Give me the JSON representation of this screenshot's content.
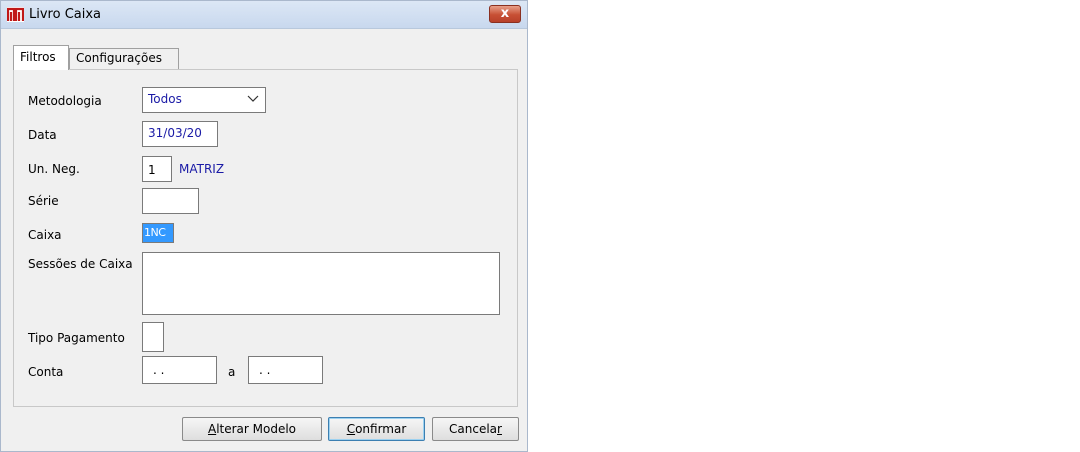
{
  "window": {
    "title": "Livro Caixa",
    "close_label": "x"
  },
  "tabs": [
    {
      "label": "Filtros",
      "active": true
    },
    {
      "label": "Configurações",
      "active": false
    }
  ],
  "form": {
    "metodologia": {
      "label": "Metodologia",
      "value": "Todos"
    },
    "data": {
      "label": "Data",
      "value": "31/03/20"
    },
    "un_neg": {
      "label": "Un. Neg.",
      "value": "1",
      "description": "MATRIZ"
    },
    "serie": {
      "label": "Série",
      "value": ""
    },
    "caixa": {
      "label": "Caixa",
      "value": "1NC"
    },
    "sessoes": {
      "label": "Sessões de Caixa",
      "value": ""
    },
    "tipo_pagamento": {
      "label": "Tipo Pagamento",
      "value": ""
    },
    "conta": {
      "label": "Conta",
      "from": ". .",
      "separator": "a",
      "to": ". ."
    }
  },
  "buttons": {
    "alterar_modelo": {
      "accel": "A",
      "rest": "lterar Modelo"
    },
    "confirmar": {
      "accel": "C",
      "rest": "onfirmar"
    },
    "cancelar": {
      "prefix": "Cancela",
      "accel": "r"
    }
  },
  "colors": {
    "value_text": "#1a1aa6",
    "selection": "#3399ff"
  }
}
